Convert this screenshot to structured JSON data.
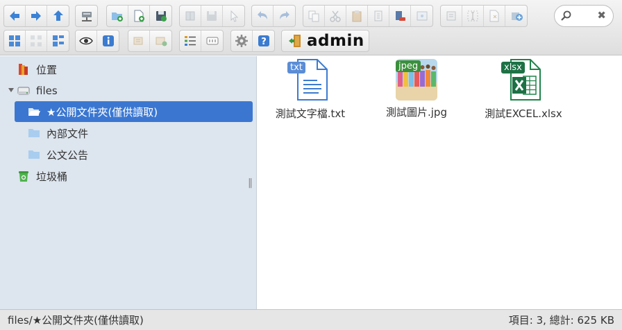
{
  "toolbar": {
    "current_dir": "admin",
    "search": {
      "value": "",
      "placeholder": ""
    }
  },
  "sidebar": {
    "places_label": "位置",
    "root_label": "files",
    "folders": [
      {
        "label": "★公開文件夾(僅供讀取)",
        "selected": true
      },
      {
        "label": "內部文件",
        "selected": false
      },
      {
        "label": "公文公告",
        "selected": false
      }
    ],
    "trash_label": "垃圾桶"
  },
  "files": [
    {
      "name": "測試文字檔.txt",
      "badge": "txt",
      "icon": "text-file-icon",
      "badge_color": "#5b8dd6"
    },
    {
      "name": "測試圖片.jpg",
      "badge": "jpeg",
      "icon": "image-thumbnail",
      "badge_color": "#3b8f3b"
    },
    {
      "name": "測試EXCEL.xlsx",
      "badge": "xlsx",
      "icon": "excel-file-icon",
      "badge_color": "#1e7145"
    }
  ],
  "statusbar": {
    "path": "files/★公開文件夾(僅供讀取)",
    "summary": "項目: 3, 總計: 625 KB"
  },
  "colors": {
    "selection": "#3b77d1",
    "sidebar_bg": "#dde5ee"
  }
}
